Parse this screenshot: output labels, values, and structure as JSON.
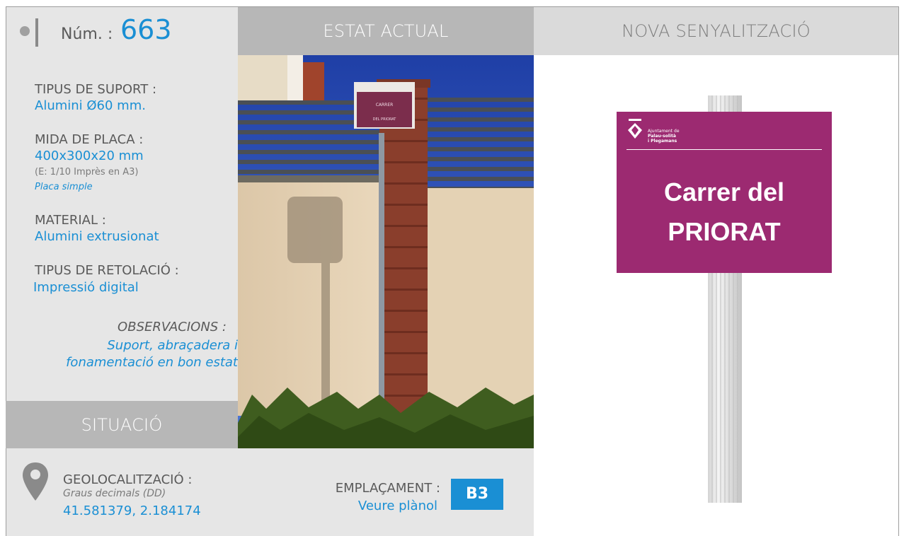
{
  "header": {
    "num_label": "Núm. :",
    "num_value": "663",
    "estat_title": "ESTAT ACTUAL",
    "nova_title": "NOVA SENYALITZACIÓ"
  },
  "specs": {
    "tipus_suport_label": "TIPUS DE SUPORT :",
    "tipus_suport_value": "Alumini Ø60 mm.",
    "mida_label": "MIDA DE PLACA :",
    "mida_value": "400x300x20 mm",
    "mida_scale": "(E: 1/10 Imprès en A3)",
    "mida_note": "Placa simple",
    "material_label": "MATERIAL :",
    "material_value": "Alumini extrusionat",
    "retolacio_label": "TIPUS DE RETOLACIÓ :",
    "retolacio_value": "Impressió digital",
    "observacions_label": "OBSERVACIONS :",
    "observacions_line1": "Suport, abraçadera i",
    "observacions_line2": "fonamentació en bon estat"
  },
  "situacio": {
    "title": "SITUACIÓ",
    "geo_label": "GEOLOCALITZACIÓ :",
    "geo_format": "Graus decimals (DD)",
    "geo_value": "41.581379, 2.184174",
    "emplacament_label": "EMPLAÇAMENT :",
    "emplacament_link": "Veure plànol",
    "emplacament_code": "B3"
  },
  "photo_sign": {
    "line1": "CARRER",
    "line2": "DEL PRIORAT"
  },
  "new_sign": {
    "logo_line1": "Ajuntament de",
    "logo_line2": "Palau-solità",
    "logo_line3": "i Plegamans",
    "street_line1": "Carrer del",
    "street_line2": "PRIORAT"
  },
  "colors": {
    "accent": "#1a8fd4",
    "sign": "#9c2a71"
  }
}
